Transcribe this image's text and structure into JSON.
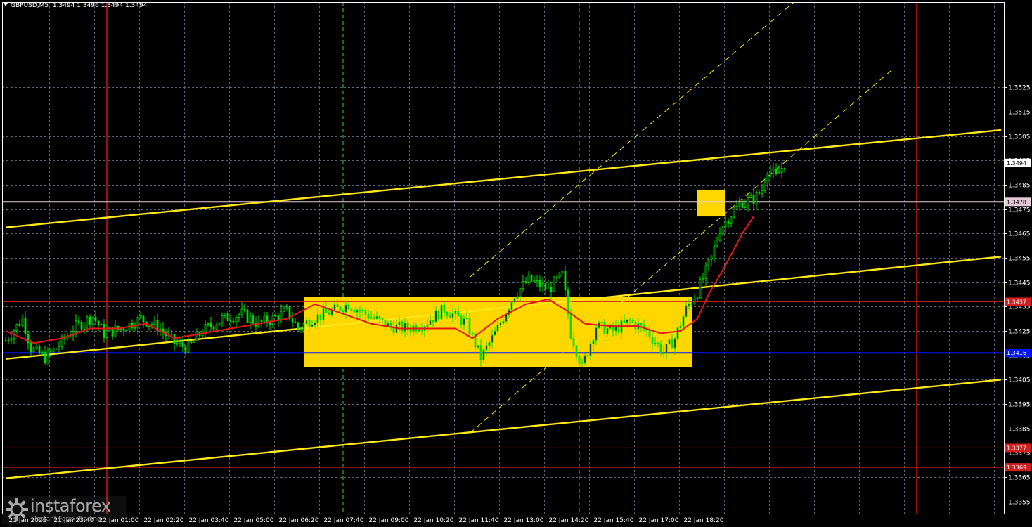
{
  "header": {
    "symbol": "GBPUSD,M5",
    "ohlc": "1.3494 1.3496 1.3494 1.3494"
  },
  "watermark": {
    "brand": "instaforex",
    "tagline": "Instant Forex Trading"
  },
  "colors": {
    "background": "#000000",
    "grid": "#5a6470",
    "axis": "#ffffff",
    "candles": "#00e000",
    "moving_average": "#e8141a",
    "channel_lines": "#ffe81a",
    "channel_dashed": "#ffe81a",
    "sideways_box": "#ffd700",
    "support_line": "#0015ff",
    "level_1_3478": "#e6c8d6",
    "level_red": "#d21e1e",
    "session_dividers": "#ff1a1a",
    "vertical_dashed": "#2ecc71"
  },
  "chart_data": {
    "type": "candlestick",
    "symbol": "GBPUSD",
    "timeframe": "M5",
    "price_axis": {
      "min": 1.335,
      "max": 1.356,
      "ticks": [
        "1.3355",
        "1.3365",
        "1.3375",
        "1.3385",
        "1.3395",
        "1.3405",
        "1.3415",
        "1.3425",
        "1.3435",
        "1.3445",
        "1.3455",
        "1.3465",
        "1.3475",
        "1.3485",
        "1.3495",
        "1.3505",
        "1.3515",
        "1.3525"
      ]
    },
    "time_axis": {
      "ticks": [
        "21 Jan 2025",
        "21 Jan 23:40",
        "22 Jan 01:00",
        "22 Jan 02:20",
        "22 Jan 03:40",
        "22 Jan 05:00",
        "22 Jan 06:20",
        "22 Jan 07:40",
        "22 Jan 09:00",
        "22 Jan 10:20",
        "22 Jan 11:40",
        "22 Jan 13:00",
        "22 Jan 14:20",
        "22 Jan 15:40",
        "22 Jan 17:00",
        "22 Jan 18:20"
      ],
      "bars_between_ticks": 16
    },
    "price_path": [
      [
        0,
        1.3421
      ],
      [
        6,
        1.343
      ],
      [
        9,
        1.3418
      ],
      [
        14,
        1.3414
      ],
      [
        19,
        1.3419
      ],
      [
        24,
        1.3426
      ],
      [
        31,
        1.3431
      ],
      [
        35,
        1.3424
      ],
      [
        41,
        1.3426
      ],
      [
        48,
        1.343
      ],
      [
        54,
        1.3427
      ],
      [
        60,
        1.342
      ],
      [
        65,
        1.3418
      ],
      [
        70,
        1.3425
      ],
      [
        77,
        1.343
      ],
      [
        84,
        1.3432
      ],
      [
        90,
        1.3428
      ],
      [
        95,
        1.343
      ],
      [
        100,
        1.3433
      ],
      [
        104,
        1.3426
      ],
      [
        109,
        1.343
      ],
      [
        116,
        1.3433
      ],
      [
        122,
        1.3436
      ],
      [
        128,
        1.3432
      ],
      [
        136,
        1.3427
      ],
      [
        143,
        1.3426
      ],
      [
        149,
        1.3428
      ],
      [
        156,
        1.3434
      ],
      [
        164,
        1.3428
      ],
      [
        169,
        1.3414
      ],
      [
        175,
        1.3426
      ],
      [
        181,
        1.344
      ],
      [
        186,
        1.3446
      ],
      [
        193,
        1.3442
      ],
      [
        198,
        1.3448
      ],
      [
        201,
        1.3424
      ],
      [
        205,
        1.341
      ],
      [
        210,
        1.3427
      ],
      [
        216,
        1.3425
      ],
      [
        222,
        1.3429
      ],
      [
        228,
        1.3425
      ],
      [
        234,
        1.3416
      ],
      [
        238,
        1.3422
      ],
      [
        242,
        1.3434
      ],
      [
        246,
        1.3441
      ],
      [
        251,
        1.3455
      ],
      [
        254,
        1.3467
      ],
      [
        258,
        1.3473
      ],
      [
        262,
        1.3478
      ],
      [
        266,
        1.3479
      ],
      [
        269,
        1.3483
      ],
      [
        271,
        1.3492
      ],
      [
        274,
        1.3488
      ],
      [
        277,
        1.3494
      ]
    ],
    "moving_average": [
      [
        0,
        1.3425
      ],
      [
        10,
        1.342
      ],
      [
        20,
        1.3422
      ],
      [
        30,
        1.3426
      ],
      [
        40,
        1.3426
      ],
      [
        50,
        1.3428
      ],
      [
        60,
        1.3422
      ],
      [
        70,
        1.3424
      ],
      [
        80,
        1.3426
      ],
      [
        90,
        1.3428
      ],
      [
        100,
        1.343
      ],
      [
        110,
        1.3436
      ],
      [
        120,
        1.3432
      ],
      [
        130,
        1.3428
      ],
      [
        140,
        1.3426
      ],
      [
        150,
        1.3426
      ],
      [
        160,
        1.3426
      ],
      [
        166,
        1.3422
      ],
      [
        175,
        1.343
      ],
      [
        185,
        1.3436
      ],
      [
        193,
        1.3438
      ],
      [
        200,
        1.3433
      ],
      [
        206,
        1.3428
      ],
      [
        215,
        1.3427
      ],
      [
        225,
        1.3427
      ],
      [
        233,
        1.3424
      ],
      [
        240,
        1.3425
      ],
      [
        246,
        1.343
      ],
      [
        250,
        1.344
      ],
      [
        256,
        1.3452
      ],
      [
        262,
        1.3465
      ],
      [
        266,
        1.3472
      ]
    ],
    "channel_lines": [
      {
        "style": "solid",
        "from": [
          0,
          1.34675
        ],
        "to": [
          354,
          1.35075
        ]
      },
      {
        "style": "solid",
        "from": [
          0,
          1.34135
        ],
        "to": [
          354,
          1.34555
        ]
      },
      {
        "style": "solid",
        "from": [
          0,
          1.33645
        ],
        "to": [
          354,
          1.3405
        ]
      },
      {
        "style": "dashed",
        "from": [
          165,
          1.3383
        ],
        "to": [
          315,
          1.3532
        ]
      },
      {
        "style": "dashed",
        "from": [
          165,
          1.3447
        ],
        "to": [
          315,
          1.3594
        ]
      }
    ],
    "horizontal_levels": [
      {
        "price": 1.3478,
        "label": "1.3478",
        "style": "level_1_3478",
        "width": 2
      },
      {
        "price": 1.3437,
        "label": "1.3437",
        "style": "level_red",
        "width": 1
      },
      {
        "price": 1.3416,
        "label": "1.3416",
        "style": "support_line",
        "width": 2
      },
      {
        "price": 1.3377,
        "label": "1.3377",
        "style": "level_red",
        "width": 1
      },
      {
        "price": 1.3369,
        "label": "1.3369",
        "style": "level_red",
        "width": 1
      }
    ],
    "current_price": {
      "price": 1.3494,
      "label": "1.3494"
    },
    "boxes": [
      {
        "from_bar": 106,
        "to_bar": 244,
        "price_high": 1.3439,
        "price_low": 1.341
      },
      {
        "from_bar": 246,
        "to_bar": 256,
        "price_high": 1.3483,
        "price_low": 1.3472
      }
    ],
    "session_dividers_bar": [
      36,
      324
    ],
    "dashed_verticals_bar": [
      120,
      204
    ],
    "grid": true
  }
}
